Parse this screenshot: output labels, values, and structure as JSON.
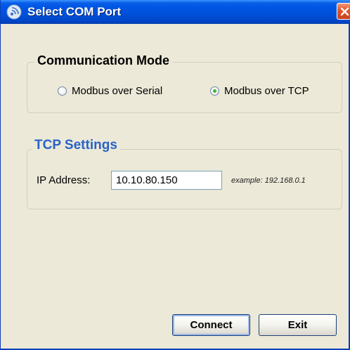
{
  "window": {
    "title": "Select COM Port",
    "icon": "signal-app-icon",
    "close_icon": "close-x-icon"
  },
  "communication_mode": {
    "legend": "Communication Mode",
    "options": [
      {
        "label": "Modbus over Serial",
        "checked": false
      },
      {
        "label": "Modbus over TCP",
        "checked": true
      }
    ]
  },
  "tcp_settings": {
    "legend": "TCP Settings",
    "ip_label": "IP Address:",
    "ip_value": "10.10.80.150",
    "ip_hint": "example: 192.168.0.1"
  },
  "buttons": {
    "connect": "Connect",
    "exit": "Exit"
  },
  "colors": {
    "titlebar": "#0055e5",
    "tcp_legend": "#2a62c8",
    "close_button": "#e3572b",
    "window_bg": "#ece9d8"
  }
}
